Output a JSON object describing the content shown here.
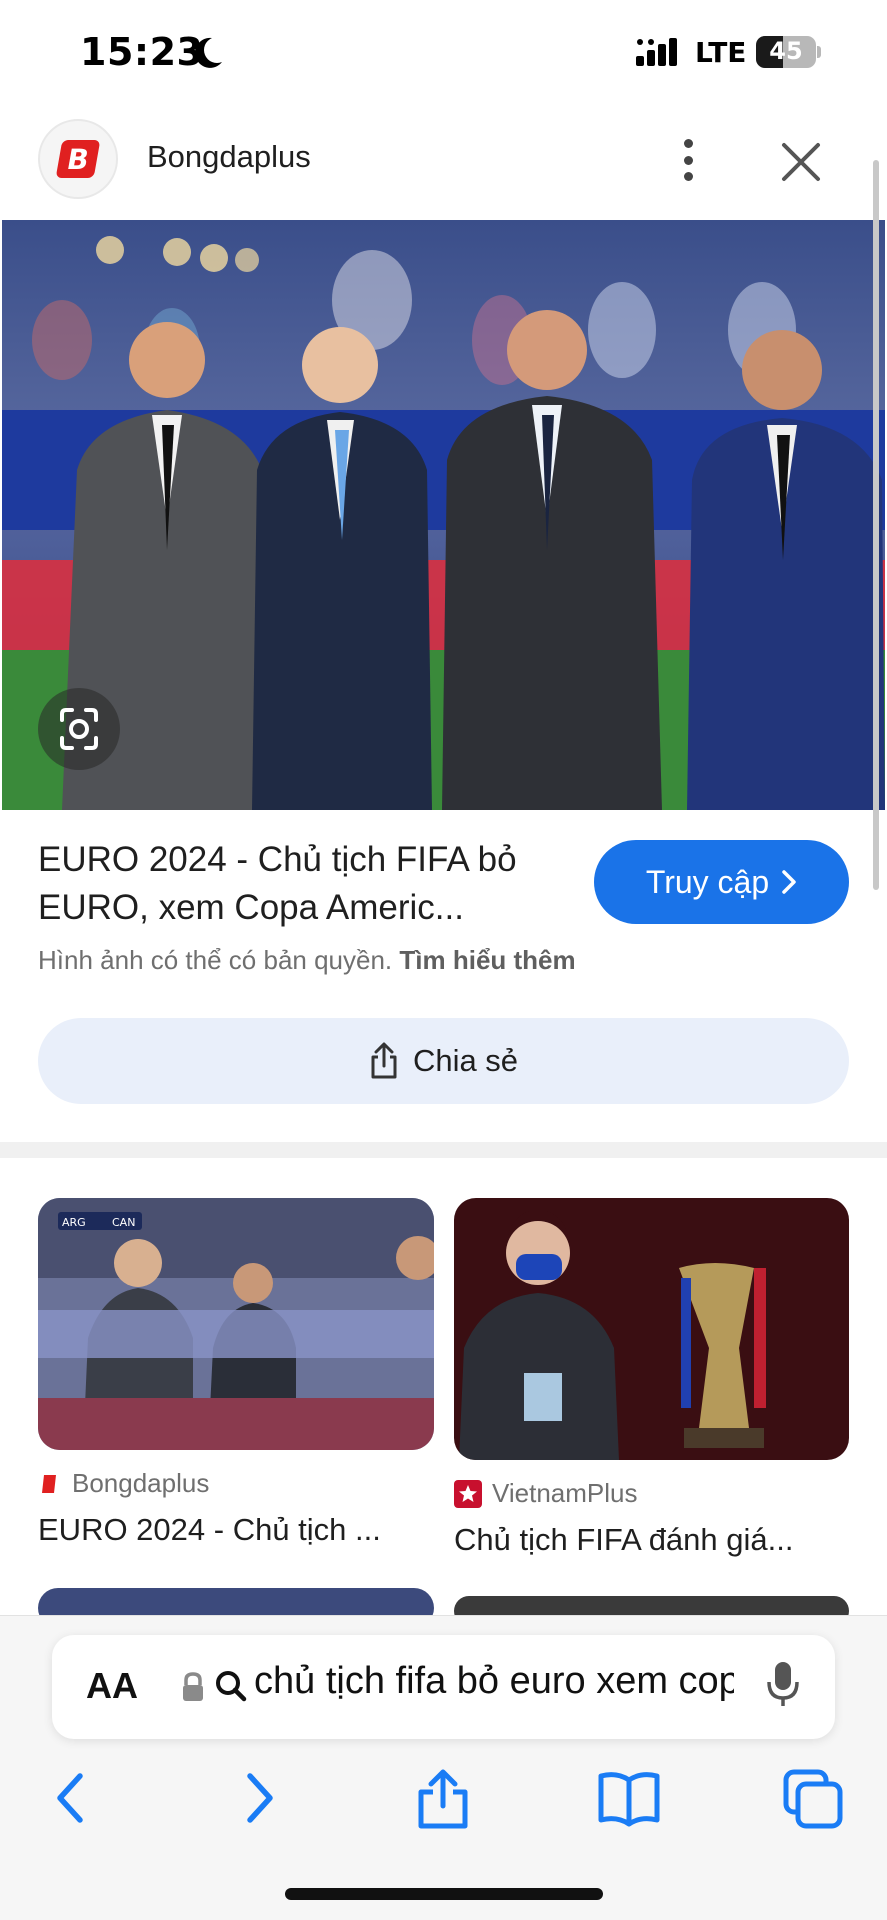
{
  "status_bar": {
    "time": "15:23",
    "network": "LTE",
    "battery": "45"
  },
  "header": {
    "site_name": "Bongdaplus"
  },
  "caption": {
    "title": "EURO 2024 - Chủ tịch FIFA bỏ EURO, xem Copa Americ...",
    "visit_label": "Truy cập",
    "copyright_text": "Hình ảnh có thể có bản quyền.",
    "learn_more": "Tìm hiểu thêm",
    "share_label": "Chia sẻ"
  },
  "related": [
    {
      "source": "Bongdaplus",
      "title": "EURO 2024 - Chủ tịch ..."
    },
    {
      "source": "VietnamPlus",
      "title": "Chủ tịch FIFA đánh giá..."
    }
  ],
  "thumb_score": {
    "home": "ARG",
    "away": "CAN"
  },
  "address_bar": {
    "aa_label": "AA",
    "query": "chủ tịch fifa bỏ euro xem copa america"
  },
  "colors": {
    "accent": "#1a73e8",
    "share_bg": "#e9effa",
    "safari_blue": "#1a7cf5"
  },
  "icons": [
    "moon-icon",
    "signal-icon",
    "battery-icon",
    "more-vert-icon",
    "close-icon",
    "lens-icon",
    "chevron-right-icon",
    "share-icon",
    "lock-icon",
    "search-icon",
    "mic-icon",
    "back-icon",
    "forward-icon",
    "safari-share-icon",
    "bookmarks-icon",
    "tabs-icon"
  ]
}
